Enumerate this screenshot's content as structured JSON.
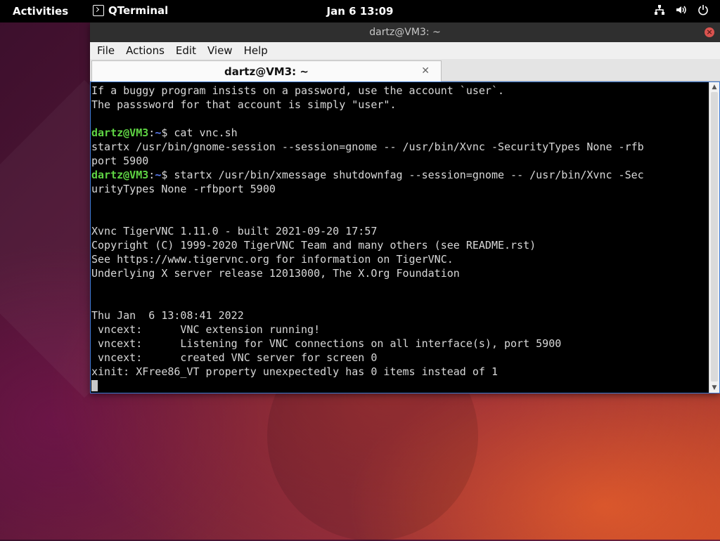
{
  "topbar": {
    "activities": "Activities",
    "app_name": "QTerminal",
    "clock": "Jan 6  13:09",
    "icons": [
      "network-icon",
      "volume-icon",
      "power-icon"
    ]
  },
  "window": {
    "title": "dartz@VM3: ~",
    "menu": [
      "File",
      "Actions",
      "Edit",
      "View",
      "Help"
    ],
    "tab_title": "dartz@VM3: ~"
  },
  "terminal": {
    "colors": {
      "user": "#5fd444",
      "path": "#5b7cf0",
      "text": "#d8d8d8"
    },
    "lines": [
      {
        "text": "If a buggy program insists on a password, use the account `user`."
      },
      {
        "text": "The passsword for that account is simply \"user\"."
      },
      {
        "text": ""
      },
      {
        "user": "dartz@VM3",
        "path": "~",
        "cmd": "$ cat vnc.sh"
      },
      {
        "text": "startx /usr/bin/gnome-session --session=gnome -- /usr/bin/Xvnc -SecurityTypes None -rfb"
      },
      {
        "text": "port 5900"
      },
      {
        "user": "dartz@VM3",
        "path": "~",
        "cmd": "$ startx /usr/bin/xmessage shutdownfag --session=gnome -- /usr/bin/Xvnc -Sec"
      },
      {
        "text": "urityTypes None -rfbport 5900"
      },
      {
        "text": ""
      },
      {
        "text": ""
      },
      {
        "text": "Xvnc TigerVNC 1.11.0 - built 2021-09-20 17:57"
      },
      {
        "text": "Copyright (C) 1999-2020 TigerVNC Team and many others (see README.rst)"
      },
      {
        "text": "See https://www.tigervnc.org for information on TigerVNC."
      },
      {
        "text": "Underlying X server release 12013000, The X.Org Foundation"
      },
      {
        "text": ""
      },
      {
        "text": ""
      },
      {
        "text": "Thu Jan  6 13:08:41 2022"
      },
      {
        "text": " vncext:      VNC extension running!"
      },
      {
        "text": " vncext:      Listening for VNC connections on all interface(s), port 5900"
      },
      {
        "text": " vncext:      created VNC server for screen 0"
      },
      {
        "text": "xinit: XFree86_VT property unexpectedly has 0 items instead of 1"
      },
      {
        "cursor": true
      }
    ]
  }
}
